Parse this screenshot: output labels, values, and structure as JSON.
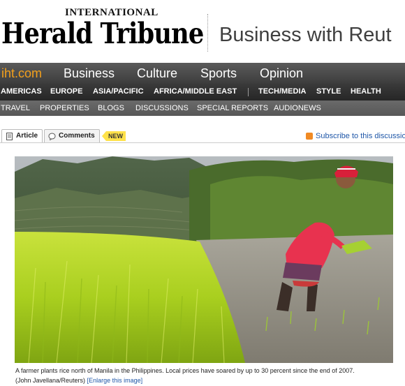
{
  "masthead": {
    "kicker": "INTERNATIONAL",
    "name": "Herald Tribune",
    "section": "Business with Reut"
  },
  "nav_primary": {
    "brand": "iht.com",
    "items": [
      "Business",
      "Culture",
      "Sports",
      "Opinion"
    ]
  },
  "nav_regions": {
    "items": [
      "AMERICAS",
      "EUROPE",
      "ASIA/PACIFIC",
      "AFRICA/MIDDLE EAST",
      "TECH/MEDIA",
      "STYLE",
      "HEALTH"
    ]
  },
  "nav_sub": {
    "items": [
      "TRAVEL",
      "PROPERTIES",
      "BLOGS",
      "DISCUSSIONS",
      "SPECIAL REPORTS",
      "AUDIONEWS"
    ]
  },
  "tabs": {
    "article": "Article",
    "comments": "Comments",
    "badge": "NEW"
  },
  "subscribe": {
    "label": "Subscribe to this discussion",
    "icon": "rss-icon"
  },
  "photo": {
    "caption": "A farmer plants rice north of Manila in the Philippines. Local prices have soared by up to 30 percent since the end of 2007.",
    "credit": "(John Javellana/Reuters)",
    "enlarge": "[Enlarge this image]"
  },
  "colors": {
    "brand_orange": "#f3a01c",
    "link_blue": "#1f57a8",
    "badge_yellow": "#ffe24a"
  }
}
